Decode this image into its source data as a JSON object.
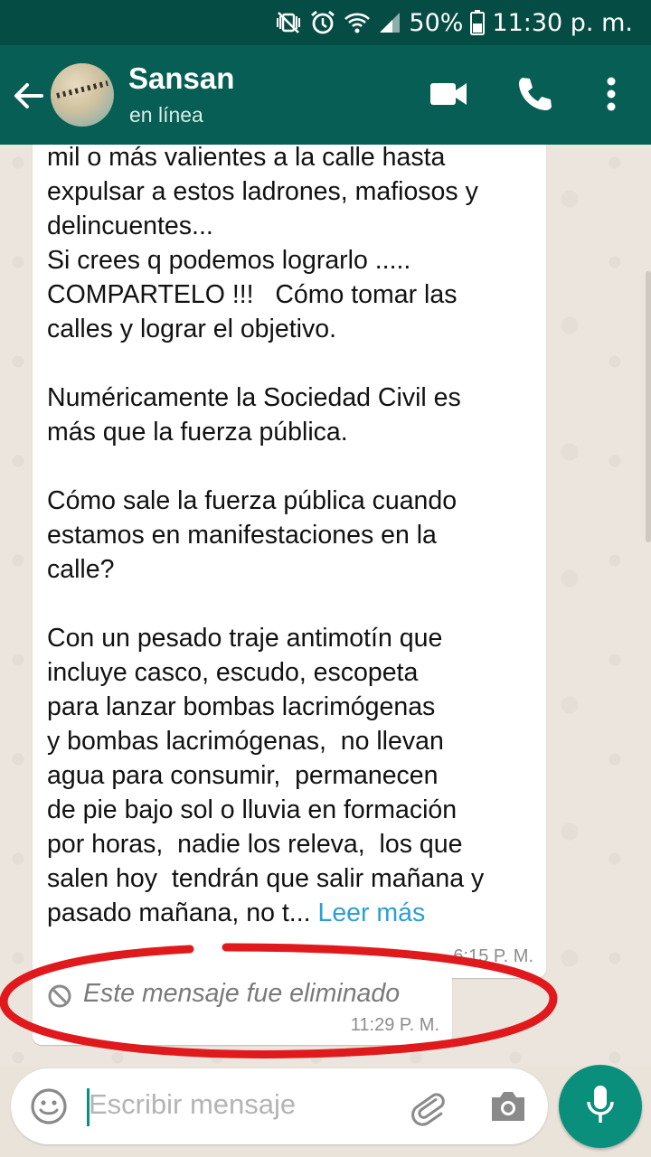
{
  "status_bar": {
    "battery": "50%",
    "time": "11:30 p. m."
  },
  "header": {
    "contact_name": "Sansan",
    "contact_status": "en línea"
  },
  "messages": [
    {
      "text": "mil o más valientes a la calle hasta\nexpulsar a estos ladrones, mafiosos y\ndelincuentes...\nSi crees q podemos lograrlo .....\nCOMPARTELO !!!   Cómo tomar las\ncalles y lograr el objetivo.\n\nNuméricamente la Sociedad Civil es\nmás que la fuerza pública.\n\nCómo sale la fuerza pública cuando\nestamos en manifestaciones en la\ncalle?\n\nCon un pesado traje antimotín que\nincluye casco, escudo, escopeta\npara lanzar bombas lacrimógenas\ny bombas lacrimógenas,  no llevan\nagua para consumir,  permanecen\nde pie bajo sol o lluvia en formación\npor horas,  nadie los releva,  los que\nsalen hoy  tendrán que salir mañana y\npasado mañana, no t... ",
      "read_more": "Leer más",
      "time": "6:15 P. M."
    },
    {
      "text": "Este mensaje fue eliminado",
      "time": "11:29 P. M."
    }
  ],
  "composer": {
    "placeholder": "Escribir mensaje"
  },
  "colors": {
    "header": "#075e54",
    "status_bar": "#054d44",
    "accent": "#0a8f7d",
    "link": "#2a9fd8",
    "annotation": "#e0191c"
  }
}
